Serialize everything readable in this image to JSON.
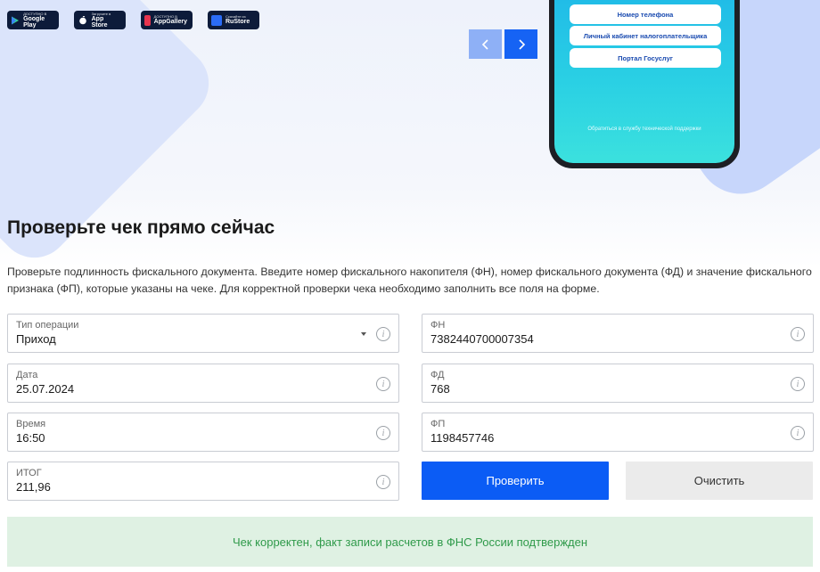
{
  "stores": [
    {
      "small": "ДОСТУПНО В",
      "big": "Google Play",
      "icon": "google-play-icon"
    },
    {
      "small": "Загрузите в",
      "big": "App Store",
      "icon": "apple-icon"
    },
    {
      "small": "ДОСТУПНО В",
      "big": "AppGallery",
      "icon": "appgallery-icon"
    },
    {
      "small": "Скачайте из",
      "big": "RuStore",
      "icon": "rustore-icon"
    }
  ],
  "phone": {
    "buttons": [
      "Номер телефона",
      "Личный кабинет налогоплательщика",
      "Портал Госуслуг"
    ],
    "support": "Обратиться в службу технической поддержки"
  },
  "heading": "Проверьте чек прямо сейчас",
  "description": "Проверьте подлинность фискального документа. Введите номер фискального накопителя (ФН), номер фискального документа (ФД) и значение фискального признака (ФП), которые указаны на чеке. Для корректной проверки чека необходимо заполнить все поля на форме.",
  "form": {
    "operation": {
      "label": "Тип операции",
      "value": "Приход"
    },
    "date": {
      "label": "Дата",
      "value": "25.07.2024"
    },
    "time": {
      "label": "Время",
      "value": "16:50"
    },
    "total": {
      "label": "ИТОГ",
      "value": "211,96"
    },
    "fn": {
      "label": "ФН",
      "value": "7382440700007354"
    },
    "fd": {
      "label": "ФД",
      "value": "768"
    },
    "fp": {
      "label": "ФП",
      "value": "1198457746"
    },
    "info_glyph": "i"
  },
  "buttons": {
    "check": "Проверить",
    "clear": "Очистить"
  },
  "result": "Чек корректен, факт записи расчетов в ФНС России подтвержден",
  "colors": {
    "primary": "#0b5cf5",
    "success_bg": "#dff1e3",
    "success_text": "#2f9a4a"
  }
}
